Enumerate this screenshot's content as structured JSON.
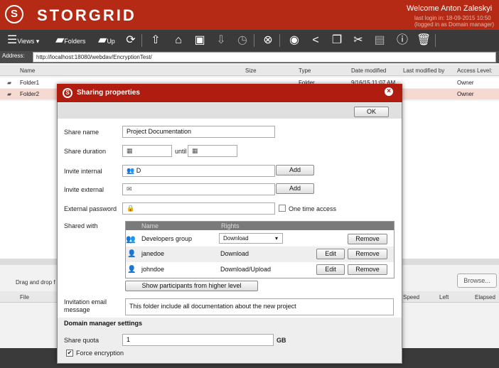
{
  "header": {
    "brand": "STORGRID",
    "welcome": "Welcome Anton Zaleskyi",
    "last_login": "last login in: 18-09-2015 10:50",
    "logged_as": "(logged in as Domain manager)"
  },
  "toolbar": {
    "views_label": "Views",
    "folders_label": "Folders",
    "up_label": "Up"
  },
  "address": {
    "label": "Address:",
    "value": "http://localhost:18080/webdav/EncryptionTest/"
  },
  "file_list": {
    "columns": [
      "Name",
      "Size",
      "Type",
      "Date modified",
      "Last modified by",
      "Access Level:"
    ],
    "rows": [
      {
        "name": "Folder1",
        "type": "Folder",
        "date": "9/16/15 11:07 AM",
        "access": "Owner"
      },
      {
        "name": "Folder2",
        "access": "Owner"
      }
    ]
  },
  "upload": {
    "drag_text": "Drag and drop f",
    "browse_label": "Browse...",
    "columns": [
      "File",
      "Speed",
      "Left",
      "Elapsed"
    ]
  },
  "dialog": {
    "title": "Sharing properties",
    "ok_label": "OK",
    "share_name_label": "Share name",
    "share_name_value": "Project Documentation",
    "duration_label": "Share duration",
    "until_label": "until",
    "invite_internal_label": "Invite internal",
    "invite_internal_value": "D",
    "invite_external_label": "Invite external",
    "add_label": "Add",
    "password_label": "External password",
    "one_time_label": "One time access",
    "shared_with_label": "Shared with",
    "table_headers": [
      "Name",
      "Rights"
    ],
    "participants": [
      {
        "name": "Developers group",
        "rights": "Download",
        "edit": "",
        "remove": "Remove"
      },
      {
        "name": "janedoe",
        "rights": "Download",
        "edit": "Edit",
        "remove": "Remove"
      },
      {
        "name": "johndoe",
        "rights": "Download/Upload",
        "edit": "Edit",
        "remove": "Remove"
      }
    ],
    "show_participants_label": "Show participants from higher level",
    "invitation_label_1": "Invitation email",
    "invitation_label_2": "message",
    "invitation_value": "This folder include all documentation about the new project",
    "domain_section_title": "Domain manager settings",
    "quota_label": "Share quota",
    "quota_value": "1",
    "quota_unit": "GB",
    "force_encryption_label": "Force encryption"
  },
  "colors": {
    "brand_red": "#b42a15",
    "dialog_red": "#b01c10",
    "toolbar_dark": "#3a3a3a"
  }
}
